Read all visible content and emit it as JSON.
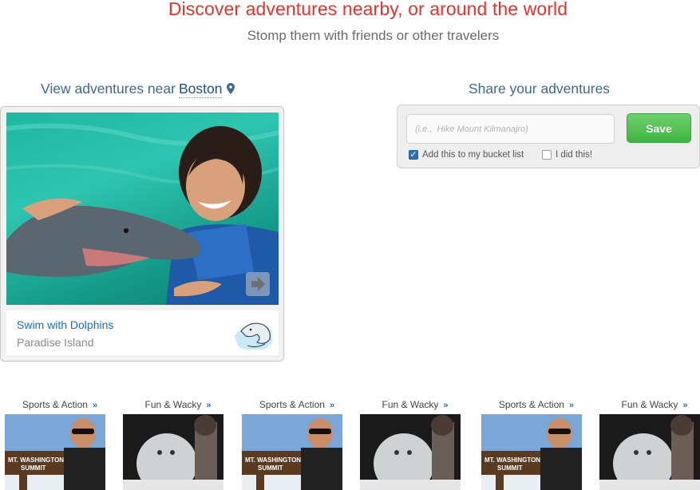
{
  "hero": {
    "title": "Discover adventures nearby, or around the world",
    "subtitle": "Stomp them with friends or other travelers"
  },
  "nearby": {
    "heading_prefix": "View adventures near",
    "city": "Boston",
    "pin_icon": "map-pin-icon"
  },
  "featured": {
    "title": "Swim with Dolphins",
    "location": "Paradise Island",
    "badge_icon": "dolphin-icon",
    "next_icon": "arrow-right-icon"
  },
  "share": {
    "heading": "Share your adventures",
    "placeholder": "(i.e.,  Hike Mount Kilmanajro)",
    "save_label": "Save",
    "bucket_label": "Add this to my bucket list",
    "bucket_checked": true,
    "did_label": "I did this!",
    "did_checked": false
  },
  "thumbnails": [
    {
      "category": "Sports & Action",
      "arrow": "»",
      "photo": "summit-sign"
    },
    {
      "category": "Fun & Wacky",
      "arrow": "»",
      "photo": "snow-figure"
    },
    {
      "category": "Sports & Action",
      "arrow": "»",
      "photo": "summit-sign"
    },
    {
      "category": "Fun & Wacky",
      "arrow": "»",
      "photo": "snow-figure"
    },
    {
      "category": "Sports & Action",
      "arrow": "»",
      "photo": "summit-sign"
    },
    {
      "category": "Fun & Wacky",
      "arrow": "»",
      "photo": "snow-figure"
    }
  ],
  "colors": {
    "hero_title": "#e8322c",
    "link_blue": "#1a6fc4",
    "heading_blue": "#3e6a8f",
    "save_green": "#3eb442"
  }
}
